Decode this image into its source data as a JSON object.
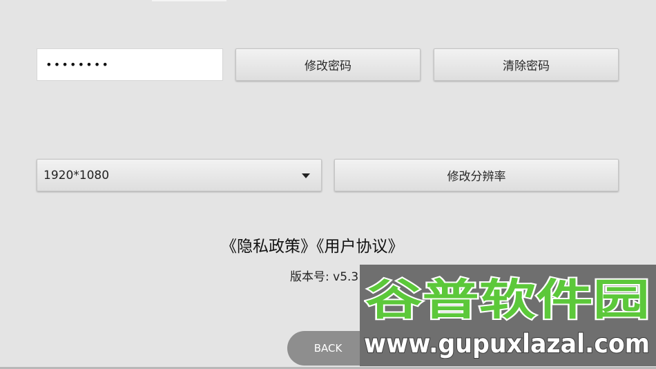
{
  "password": {
    "value": "••••••••"
  },
  "buttons": {
    "change_password": "修改密码",
    "clear_password": "清除密码",
    "change_resolution": "修改分辨率",
    "back": "BACK"
  },
  "resolution": {
    "selected": "1920*1080"
  },
  "links": {
    "privacy": "《隐私政策》",
    "agreement": "《用户协议》"
  },
  "version": {
    "text": "版本号: v5.3"
  },
  "watermark": {
    "logo_text": "谷普软件园",
    "url_text": "www.gupuxlazal.com",
    "colors": {
      "green": "#5cc83a",
      "white": "#ffffff",
      "background": "#6f6f6f"
    }
  }
}
